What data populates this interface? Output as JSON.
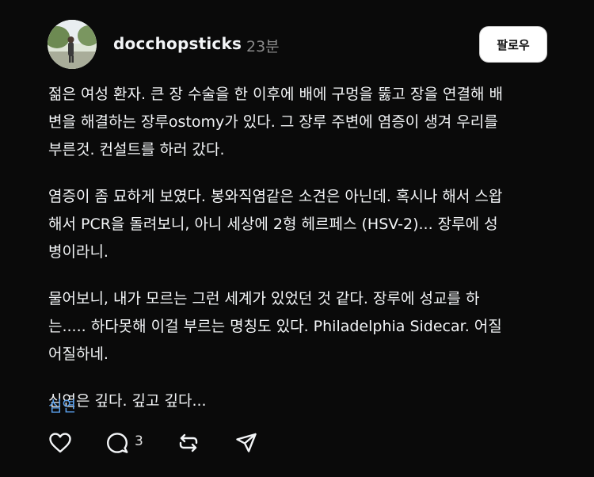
{
  "post": {
    "username": "docchopsticks",
    "time": "23분",
    "follow_label": "팔로우",
    "paragraphs": [
      "젊은 여성 환자. 큰 장 수술을 한 이후에 배에 구멍을 뚫고 장을 연결해 배\n변을 해결하는 장루ostomy가 있다. 그 장루 주변에 염증이 생겨 우리를\n부른것. 컨설트를 하러 갔다.",
      "염증이 좀 묘하게 보였다. 봉와직염같은 소견은 아닌데. 혹시나 해서 스왑\n해서 PCR을 돌려보니, 아니 세상에 2형 헤르페스 (HSV-2)... 장루에 성\n병이라니.",
      "물어보니, 내가 모르는 그런 세계가 있었던 것 같다. 장루에 성교를 하\n는..... 하다못해 이걸 부르는 명칭도 있다. Philadelphia Sidecar. 어질\n어질하네.",
      "심연은 깊다. 깊고 깊다..."
    ],
    "tag": "심연",
    "actions": {
      "like_icon": "heart-icon",
      "reply_icon": "comment-icon",
      "reply_count": "3",
      "repost_icon": "repost-icon",
      "share_icon": "send-icon"
    },
    "colors": {
      "background": "#0a0a0a",
      "text": "#f3f5f7",
      "muted": "#8a8a8a",
      "tag": "#5aa0ec"
    }
  }
}
